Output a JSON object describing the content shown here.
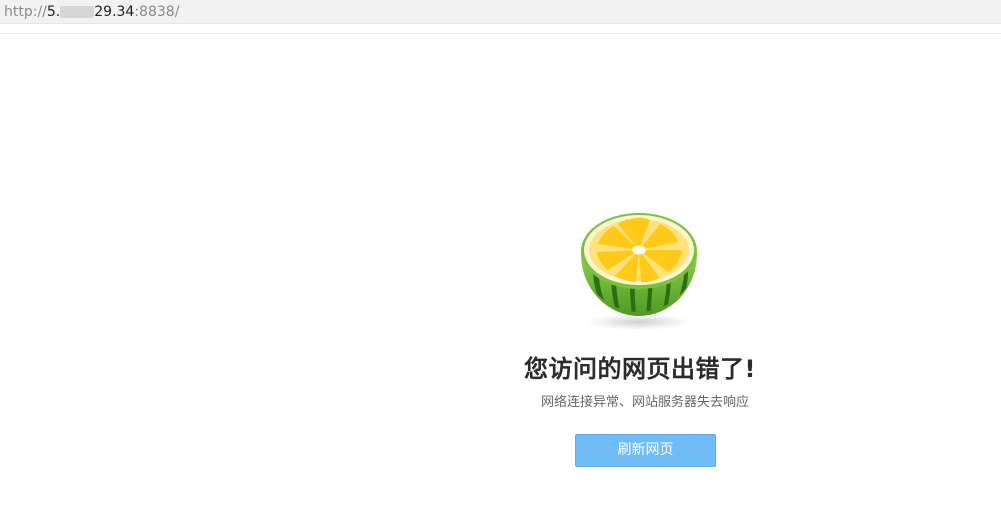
{
  "address_bar": {
    "scheme": "http://",
    "host_visible_start": "5.",
    "host_visible_end": "29.34",
    "port_path": ":8838/"
  },
  "error_page": {
    "title": "您访问的网页出错了!",
    "subtitle": "网络连接异常、网站服务器失去响应",
    "refresh_label": "刷新网页",
    "illustration_icon": "watermelon-lemon-icon"
  },
  "colors": {
    "button_bg": "#6fbcf7",
    "title": "#2b2b2b",
    "subtitle": "#666666",
    "lemon_yellow": "#ffd43a",
    "melon_green": "#5aa82a"
  }
}
